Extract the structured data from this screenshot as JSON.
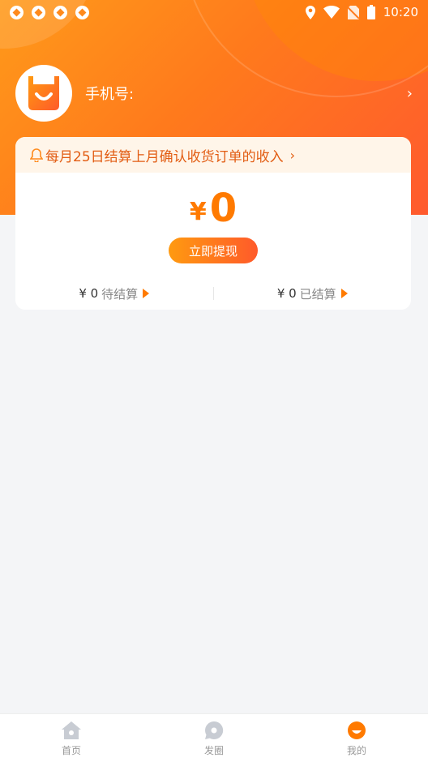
{
  "status_bar": {
    "time": "10:20",
    "icons_left": [
      "app-notification-icon",
      "app-notification-icon",
      "app-notification-icon",
      "app-notification-icon"
    ],
    "icons_right": [
      "location-icon",
      "wifi-icon",
      "no-sim-icon",
      "battery-icon"
    ]
  },
  "profile": {
    "phone_label": "手机号:",
    "chevron": "›"
  },
  "card": {
    "notice_text": "每月25日结算上月确认收货订单的收入",
    "notice_arrow": "›",
    "currency": "¥",
    "amount": "0",
    "withdraw_label": "立即提现",
    "pending_amount": "¥ 0",
    "pending_label": "待结算",
    "settled_amount": "¥ 0",
    "settled_label": "已结算"
  },
  "tabbar": {
    "items": [
      {
        "label": "首页",
        "icon": "home-icon",
        "active": false
      },
      {
        "label": "发圈",
        "icon": "chat-bubble-icon",
        "active": false
      },
      {
        "label": "我的",
        "icon": "mine-icon",
        "active": true
      }
    ]
  },
  "colors": {
    "accent": "#ff7a00",
    "notice_text": "#e25c12",
    "tab_inactive": "#c8ccd3"
  }
}
